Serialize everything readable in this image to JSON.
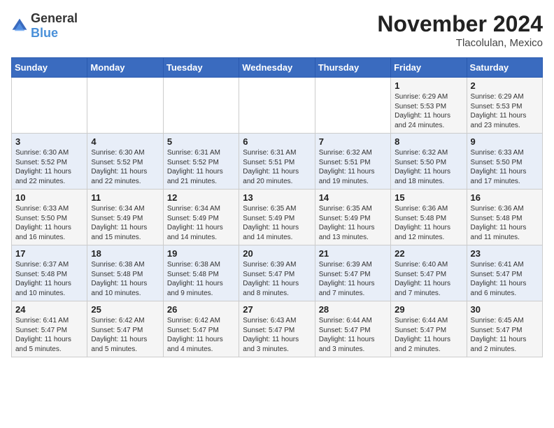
{
  "header": {
    "logo_general": "General",
    "logo_blue": "Blue",
    "month_title": "November 2024",
    "location": "Tlacolulan, Mexico"
  },
  "weekdays": [
    "Sunday",
    "Monday",
    "Tuesday",
    "Wednesday",
    "Thursday",
    "Friday",
    "Saturday"
  ],
  "weeks": [
    [
      {
        "day": "",
        "info": ""
      },
      {
        "day": "",
        "info": ""
      },
      {
        "day": "",
        "info": ""
      },
      {
        "day": "",
        "info": ""
      },
      {
        "day": "",
        "info": ""
      },
      {
        "day": "1",
        "info": "Sunrise: 6:29 AM\nSunset: 5:53 PM\nDaylight: 11 hours\nand 24 minutes."
      },
      {
        "day": "2",
        "info": "Sunrise: 6:29 AM\nSunset: 5:53 PM\nDaylight: 11 hours\nand 23 minutes."
      }
    ],
    [
      {
        "day": "3",
        "info": "Sunrise: 6:30 AM\nSunset: 5:52 PM\nDaylight: 11 hours\nand 22 minutes."
      },
      {
        "day": "4",
        "info": "Sunrise: 6:30 AM\nSunset: 5:52 PM\nDaylight: 11 hours\nand 22 minutes."
      },
      {
        "day": "5",
        "info": "Sunrise: 6:31 AM\nSunset: 5:52 PM\nDaylight: 11 hours\nand 21 minutes."
      },
      {
        "day": "6",
        "info": "Sunrise: 6:31 AM\nSunset: 5:51 PM\nDaylight: 11 hours\nand 20 minutes."
      },
      {
        "day": "7",
        "info": "Sunrise: 6:32 AM\nSunset: 5:51 PM\nDaylight: 11 hours\nand 19 minutes."
      },
      {
        "day": "8",
        "info": "Sunrise: 6:32 AM\nSunset: 5:50 PM\nDaylight: 11 hours\nand 18 minutes."
      },
      {
        "day": "9",
        "info": "Sunrise: 6:33 AM\nSunset: 5:50 PM\nDaylight: 11 hours\nand 17 minutes."
      }
    ],
    [
      {
        "day": "10",
        "info": "Sunrise: 6:33 AM\nSunset: 5:50 PM\nDaylight: 11 hours\nand 16 minutes."
      },
      {
        "day": "11",
        "info": "Sunrise: 6:34 AM\nSunset: 5:49 PM\nDaylight: 11 hours\nand 15 minutes."
      },
      {
        "day": "12",
        "info": "Sunrise: 6:34 AM\nSunset: 5:49 PM\nDaylight: 11 hours\nand 14 minutes."
      },
      {
        "day": "13",
        "info": "Sunrise: 6:35 AM\nSunset: 5:49 PM\nDaylight: 11 hours\nand 14 minutes."
      },
      {
        "day": "14",
        "info": "Sunrise: 6:35 AM\nSunset: 5:49 PM\nDaylight: 11 hours\nand 13 minutes."
      },
      {
        "day": "15",
        "info": "Sunrise: 6:36 AM\nSunset: 5:48 PM\nDaylight: 11 hours\nand 12 minutes."
      },
      {
        "day": "16",
        "info": "Sunrise: 6:36 AM\nSunset: 5:48 PM\nDaylight: 11 hours\nand 11 minutes."
      }
    ],
    [
      {
        "day": "17",
        "info": "Sunrise: 6:37 AM\nSunset: 5:48 PM\nDaylight: 11 hours\nand 10 minutes."
      },
      {
        "day": "18",
        "info": "Sunrise: 6:38 AM\nSunset: 5:48 PM\nDaylight: 11 hours\nand 10 minutes."
      },
      {
        "day": "19",
        "info": "Sunrise: 6:38 AM\nSunset: 5:48 PM\nDaylight: 11 hours\nand 9 minutes."
      },
      {
        "day": "20",
        "info": "Sunrise: 6:39 AM\nSunset: 5:47 PM\nDaylight: 11 hours\nand 8 minutes."
      },
      {
        "day": "21",
        "info": "Sunrise: 6:39 AM\nSunset: 5:47 PM\nDaylight: 11 hours\nand 7 minutes."
      },
      {
        "day": "22",
        "info": "Sunrise: 6:40 AM\nSunset: 5:47 PM\nDaylight: 11 hours\nand 7 minutes."
      },
      {
        "day": "23",
        "info": "Sunrise: 6:41 AM\nSunset: 5:47 PM\nDaylight: 11 hours\nand 6 minutes."
      }
    ],
    [
      {
        "day": "24",
        "info": "Sunrise: 6:41 AM\nSunset: 5:47 PM\nDaylight: 11 hours\nand 5 minutes."
      },
      {
        "day": "25",
        "info": "Sunrise: 6:42 AM\nSunset: 5:47 PM\nDaylight: 11 hours\nand 5 minutes."
      },
      {
        "day": "26",
        "info": "Sunrise: 6:42 AM\nSunset: 5:47 PM\nDaylight: 11 hours\nand 4 minutes."
      },
      {
        "day": "27",
        "info": "Sunrise: 6:43 AM\nSunset: 5:47 PM\nDaylight: 11 hours\nand 3 minutes."
      },
      {
        "day": "28",
        "info": "Sunrise: 6:44 AM\nSunset: 5:47 PM\nDaylight: 11 hours\nand 3 minutes."
      },
      {
        "day": "29",
        "info": "Sunrise: 6:44 AM\nSunset: 5:47 PM\nDaylight: 11 hours\nand 2 minutes."
      },
      {
        "day": "30",
        "info": "Sunrise: 6:45 AM\nSunset: 5:47 PM\nDaylight: 11 hours\nand 2 minutes."
      }
    ]
  ]
}
